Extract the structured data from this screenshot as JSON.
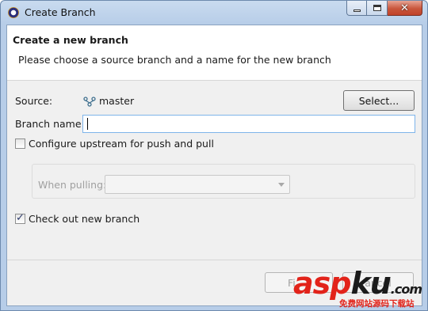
{
  "window": {
    "title": "Create Branch",
    "minimize_icon": "minimize-icon",
    "maximize_icon": "maximize-icon",
    "close_glyph": "✕"
  },
  "banner": {
    "title": "Create a new branch",
    "message": "Please choose a source branch and a name for the new branch"
  },
  "form": {
    "source_label": "Source:",
    "source_icon": "branch-icon",
    "source_value": "master",
    "select_button": "Select...",
    "branch_name_label": "Branch name:",
    "branch_name_value": "",
    "configure_upstream_label": "Configure upstream for push and pull",
    "configure_upstream_checked": false,
    "when_pulling_label": "When pulling:",
    "when_pulling_value": "",
    "checkout_label": "Check out new branch",
    "checkout_checked": true
  },
  "footer": {
    "finish_button": "Fi",
    "cancel_button": "ancel"
  },
  "watermark": {
    "main_red": "asp",
    "main_dark": "ku",
    "main_end": ".com",
    "sub": "免费网站源码下载站"
  },
  "colors": {
    "accent_focus": "#7eb4ea",
    "watermark_red": "#e2231a",
    "titlebar": "#b7cde8"
  }
}
